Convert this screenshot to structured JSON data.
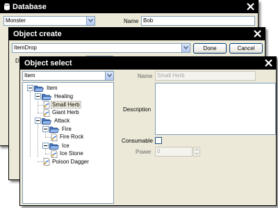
{
  "database_window": {
    "title": "Database",
    "type_select": "Monster",
    "name_label": "Name",
    "name_value": "Bob"
  },
  "object_create_window": {
    "title": "Object create",
    "type_select": "ItemDrop",
    "done_label": "Done",
    "cancel_label": "Cancel",
    "partial_label": "D"
  },
  "object_select_window": {
    "title": "Object select",
    "type_select": "Item",
    "tree": {
      "root": "Item",
      "healing": "Healing",
      "small_herb": "Small Herb",
      "giant_herb": "Giant Herb",
      "attack": "Attack",
      "fire": "Fire",
      "fire_rock": "Fire Rock",
      "ice": "Ice",
      "ice_stone": "Ice Stone",
      "poison_dagger": "Poison Dagger"
    },
    "selected_item": "Small Herb",
    "form": {
      "name_label": "Name",
      "name_value": "Small Herb",
      "description_label": "Description",
      "description_value": "",
      "consumable_label": "Consumable",
      "consumable_checked": false,
      "power_label": "Power",
      "power_value": "0"
    }
  }
}
